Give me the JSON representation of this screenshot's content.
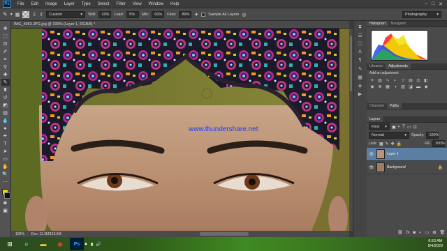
{
  "app": {
    "logo": "Ps"
  },
  "menu": [
    "File",
    "Edit",
    "Image",
    "Layer",
    "Type",
    "Select",
    "Filter",
    "View",
    "Window",
    "Help"
  ],
  "window_controls": [
    "–",
    "□",
    "✕"
  ],
  "options": {
    "mode_label": "Custom",
    "width_label": "Wdt:",
    "width_value": "10%",
    "load_label": "Load:",
    "load_value": "5%",
    "mix_label": "Mix:",
    "mix_value": "60%",
    "flow_label": "Flow:",
    "flow_value": "89%",
    "sample_label": "Sample All Layers",
    "workspace": "Photography"
  },
  "document": {
    "tab_title": "IMG_4953.JPG.jpg @ 100% (Layer 1, RGB/8) *",
    "zoom": "100%",
    "doc_info": "Doc: 11.3M/115.6M",
    "watermark": "www.thundershare.net"
  },
  "panels": {
    "histogram_tabs": [
      "Histogram",
      "Navigator"
    ],
    "lib_tabs": [
      "Libraries",
      "Adjustments"
    ],
    "add_adjustment": "Add an adjustment",
    "channel_tabs": [
      "Channels",
      "Paths"
    ],
    "layers_tab": "Layers",
    "kind_label": "Kind",
    "blend_mode": "Normal",
    "opacity_label": "Opacity:",
    "opacity_value": "100%",
    "lock_label": "Lock:",
    "fill_label": "Fill:",
    "fill_value": "100%",
    "layers": [
      {
        "name": "Layer 1",
        "selected": true
      },
      {
        "name": "Background",
        "selected": false
      }
    ]
  },
  "taskbar": {
    "time": "6:53 AM",
    "date": "5/4/2020",
    "apps": [
      "ie-icon",
      "folder-icon",
      "chrome-icon",
      "photoshop-icon"
    ]
  },
  "colors": {
    "foreground": "#f2d600",
    "background": "#111111",
    "accent": "#31a8ff",
    "watermark": "#1a3cff"
  }
}
